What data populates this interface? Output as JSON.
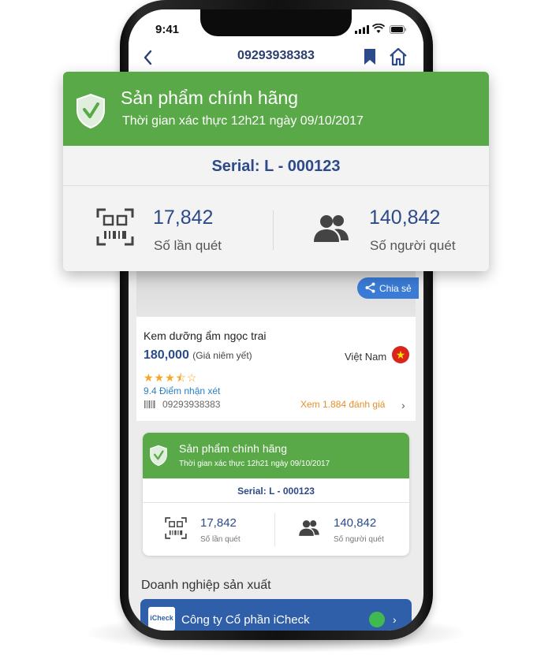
{
  "status_bar": {
    "time": "9:41"
  },
  "nav": {
    "title": "09293938383"
  },
  "product": {
    "share_label": "Chia sẻ",
    "name": "Kem dưỡng ẩm ngọc trai",
    "price": "180,000",
    "price_note": "(Giá niêm yết)",
    "country": "Việt Nam",
    "rating_stars": 3.5,
    "rating_max": 5,
    "stars_text": "★★★⯪☆",
    "score_text": "9.4 Điểm nhận xét",
    "barcode": "09293938383",
    "reviews_link": "Xem 1.884 đánh giá"
  },
  "verification": {
    "title": "Sản phẩm chính hãng",
    "subtitle": "Thời gian xác thực 12h21 ngày 09/10/2017",
    "serial": "Serial: L - 000123",
    "scan_count": "17,842",
    "scan_label": "Số lần quét",
    "people_count": "140,842",
    "people_label": "Số người quét"
  },
  "business": {
    "section_title": "Doanh nghiệp sản xuất",
    "logo_text": "iCheck",
    "company_name": "Công ty Cổ phần iCheck"
  },
  "colors": {
    "green": "#5aa948",
    "navy": "#2c4a8a",
    "share_blue": "#3a7bd5",
    "orange": "#e8902a",
    "company_blue": "#2f5fa8"
  }
}
